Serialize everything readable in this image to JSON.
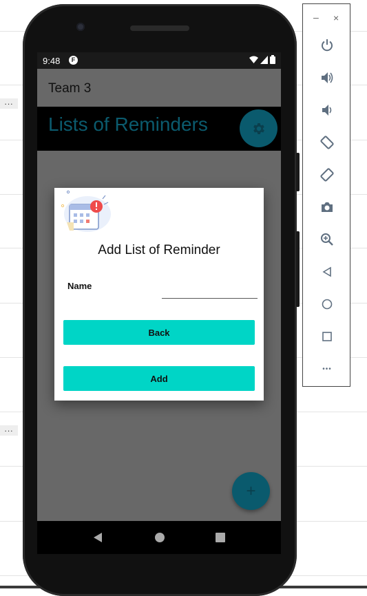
{
  "status_bar": {
    "time": "9:48",
    "app_icon_glyph": "F"
  },
  "app_bar": {
    "title": "Team 3"
  },
  "header": {
    "heading": "Lists of Reminders"
  },
  "dialog": {
    "title": "Add List of Reminder",
    "name_label": "Name",
    "name_value": "",
    "back_label": "Back",
    "add_label": "Add"
  },
  "fab": {
    "glyph": "+"
  },
  "background_panel": {
    "more_1": "...",
    "more_2": "..."
  },
  "emulator_toolbar": {
    "minimize": "–",
    "close": "×",
    "more": "•••",
    "tools": [
      "power-icon",
      "volume-up-icon",
      "volume-down-icon",
      "rotate-left-icon",
      "rotate-right-icon",
      "camera-icon",
      "zoom-in-icon",
      "back-icon",
      "home-icon",
      "overview-icon",
      "more-icon"
    ]
  },
  "colors": {
    "accent_teal": "#00d5c6",
    "dark_teal": "#0a5a6d",
    "heading_teal": "#0b5b6e",
    "screen_scrim": "#686868"
  }
}
